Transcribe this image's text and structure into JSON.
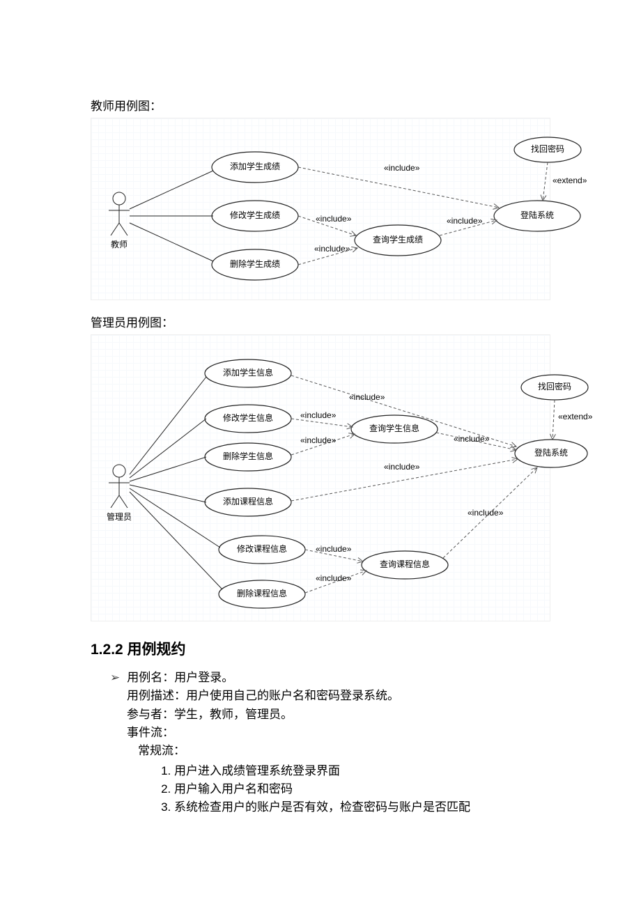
{
  "teacher_diagram": {
    "caption": "教师用例图：",
    "actor": "教师",
    "use_cases": {
      "add": "添加学生成绩",
      "edit": "修改学生成绩",
      "del": "删除学生成绩",
      "query": "查询学生成绩",
      "login": "登陆系统",
      "recover": "找回密码"
    },
    "rel": {
      "include": "«include»",
      "extend": "«extend»"
    }
  },
  "admin_diagram": {
    "caption": "管理员用例图：",
    "actor": "管理员",
    "use_cases": {
      "addS": "添加学生信息",
      "editS": "修改学生信息",
      "delS": "删除学生信息",
      "queryS": "查询学生信息",
      "addC": "添加课程信息",
      "editC": "修改课程信息",
      "delC": "删除课程信息",
      "queryC": "查询课程信息",
      "login": "登陆系统",
      "recover": "找回密码"
    },
    "rel": {
      "include": "«include»",
      "extend": "«extend»"
    }
  },
  "spec": {
    "heading": "1.2.2 用例规约",
    "name_label": "用例名：用户登录。",
    "desc": "用例描述：用户使用自己的账户名和密码登录系统。",
    "actors": "参与者：学生，教师，管理员。",
    "flow_label": "事件流：",
    "normal_flow_label": "常规流：",
    "steps": [
      "用户进入成绩管理系统登录界面",
      "用户输入用户名和密码",
      "系统检查用户的账户是否有效，检查密码与账户是否匹配"
    ]
  }
}
